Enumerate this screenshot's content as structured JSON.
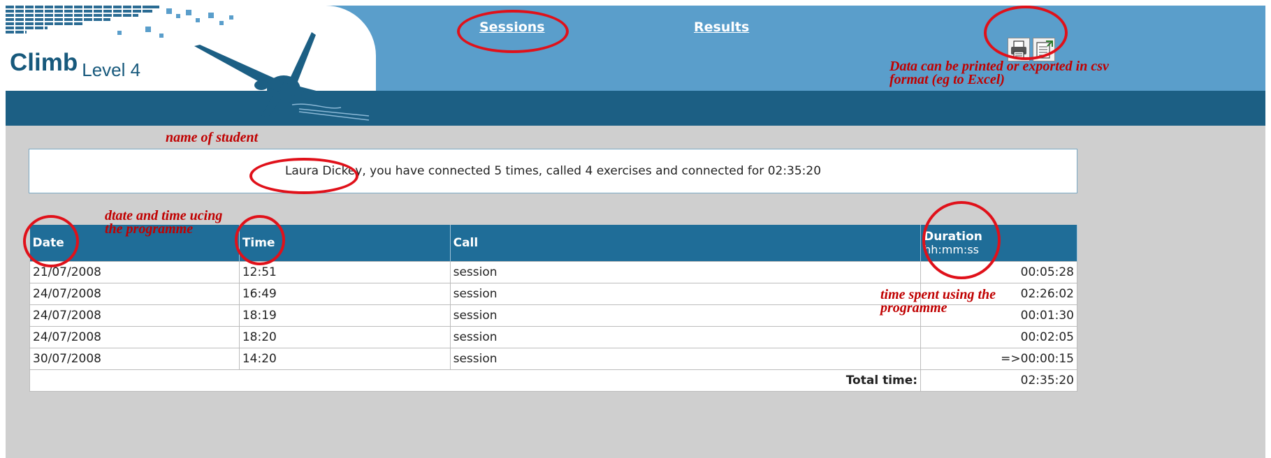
{
  "header": {
    "brand": "Climb",
    "level": "Level 4",
    "nav": {
      "sessions": "Sessions",
      "results": "Results"
    },
    "tools": {
      "print_icon": "printer-icon",
      "export_icon": "export-csv-icon"
    }
  },
  "annotations": {
    "export_note": "Data can be printed or exported in csv format (eg to Excel)",
    "name_note": "name of student",
    "date_note": "dtate and time ucing the programme",
    "duration_note": "time spent using the programme"
  },
  "summary": {
    "text": "Laura Dickey, you have connected 5 times, called 4 exercises and connected for 02:35:20"
  },
  "table": {
    "headers": {
      "date": "Date",
      "time": "Time",
      "call": "Call",
      "duration": "Duration",
      "duration_format": "hh:mm:ss"
    },
    "rows": [
      {
        "date": "21/07/2008",
        "time": "12:51",
        "call": "session",
        "duration": "00:05:28"
      },
      {
        "date": "24/07/2008",
        "time": "16:49",
        "call": "session",
        "duration": "02:26:02"
      },
      {
        "date": "24/07/2008",
        "time": "18:19",
        "call": "session",
        "duration": "00:01:30"
      },
      {
        "date": "24/07/2008",
        "time": "18:20",
        "call": "session",
        "duration": "00:02:05"
      },
      {
        "date": "30/07/2008",
        "time": "14:20",
        "call": "session",
        "duration": "=>00:00:15"
      }
    ],
    "total_label": "Total time:",
    "total_value": "02:35:20"
  }
}
